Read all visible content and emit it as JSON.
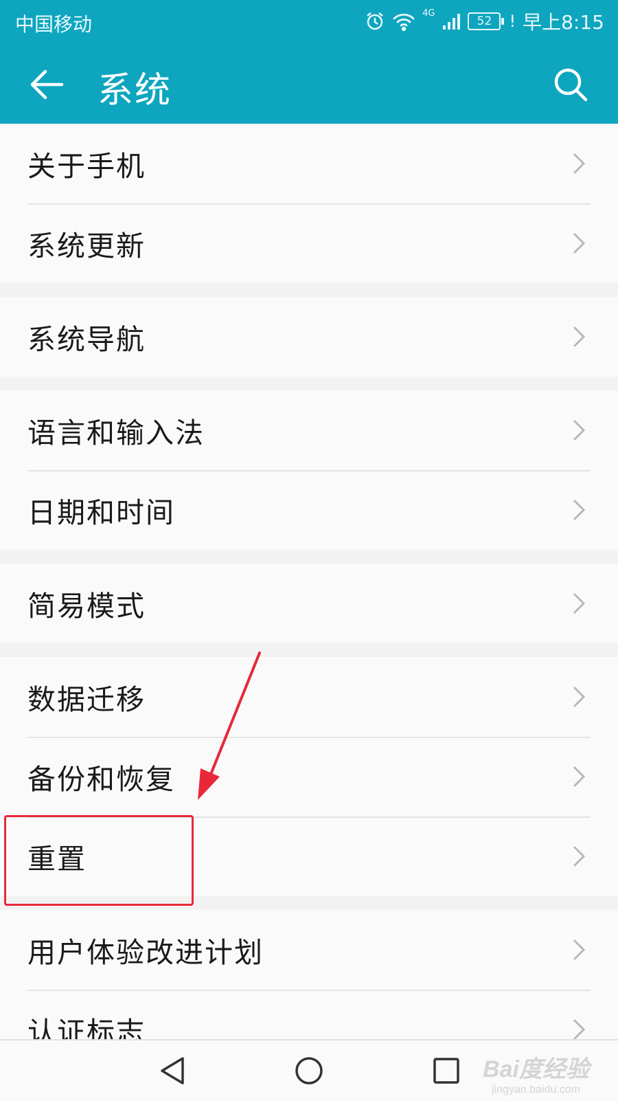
{
  "status_bar": {
    "carrier": "中国移动",
    "network": "4G",
    "battery": "52",
    "time": "早上8:15",
    "icons": [
      "alarm-icon",
      "wifi-icon",
      "signal-icon",
      "battery-icon"
    ]
  },
  "app_bar": {
    "title": "系统",
    "back_icon": "back-arrow-icon",
    "search_icon": "search-icon"
  },
  "groups": [
    {
      "items": [
        {
          "label": "关于手机"
        },
        {
          "label": "系统更新"
        }
      ]
    },
    {
      "items": [
        {
          "label": "系统导航"
        }
      ]
    },
    {
      "items": [
        {
          "label": "语言和输入法"
        },
        {
          "label": "日期和时间"
        }
      ]
    },
    {
      "items": [
        {
          "label": "简易模式"
        }
      ]
    },
    {
      "items": [
        {
          "label": "数据迁移"
        },
        {
          "label": "备份和恢复"
        },
        {
          "label": "重置"
        }
      ]
    },
    {
      "items": [
        {
          "label": "用户体验改进计划"
        },
        {
          "label": "认证标志"
        }
      ]
    }
  ],
  "annotation": {
    "highlighted_item": "重置",
    "color": "#e8283a"
  },
  "nav_bar": {
    "icons": [
      "nav-back-icon",
      "nav-home-icon",
      "nav-recent-icon"
    ]
  },
  "watermark": {
    "main": "Bai度经验",
    "sub": "jingyan.baidu.com"
  },
  "colors": {
    "accent": "#0ea5bf",
    "background": "#f2f2f2",
    "row_background": "#fafafa"
  }
}
